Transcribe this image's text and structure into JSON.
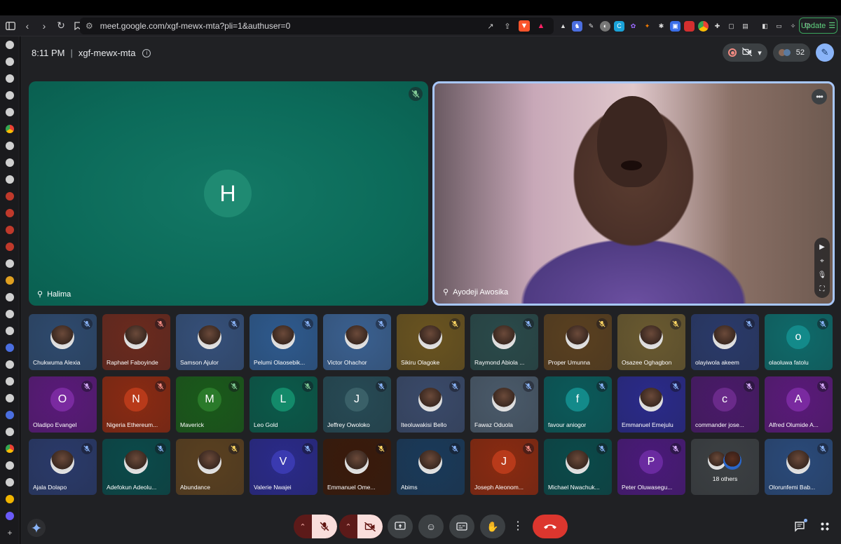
{
  "browser": {
    "url": "meet.google.com/xgf-mewx-mta?pli=1&authuser=0",
    "update_label": "Update"
  },
  "meeting": {
    "time": "8:11 PM",
    "code": "xgf-mewx-mta",
    "participant_count": "52"
  },
  "spotlight": [
    {
      "name": "Halima",
      "initial": "H"
    },
    {
      "name": "Ayodeji Awosika"
    }
  ],
  "participants": [
    {
      "name": "Chukwuma Alexia",
      "type": "photo",
      "bg": "#2e4a6e",
      "mic_color": "#8ab4f8"
    },
    {
      "name": "Raphael Faboyinde",
      "type": "photo",
      "bg": "#6b2a1e",
      "mic_color": "#f28b82"
    },
    {
      "name": "Samson Ajulor",
      "type": "photo",
      "bg": "#35507a",
      "mic_color": "#8ab4f8"
    },
    {
      "name": "Pelumi Olaosebik...",
      "type": "photo",
      "bg": "#2e5a8e",
      "mic_color": "#8ab4f8"
    },
    {
      "name": "Victor Ohachor",
      "type": "photo",
      "bg": "#3a6090",
      "mic_color": "#8ab4f8"
    },
    {
      "name": "Sikiru Olagoke",
      "type": "photo",
      "bg": "#6a5420",
      "mic_color": "#fdd663"
    },
    {
      "name": "Raymond Abiola ...",
      "type": "photo",
      "bg": "#2a4a4a",
      "mic_color": "#8ab4f8"
    },
    {
      "name": "Proper Umunna",
      "type": "photo",
      "bg": "#5a4020",
      "mic_color": "#fdd663"
    },
    {
      "name": "Osazee Oghagbon",
      "type": "photo",
      "bg": "#6a5a30",
      "mic_color": "#fdd663"
    },
    {
      "name": "olayiwola akeem",
      "type": "photo",
      "bg": "#2a3a6a",
      "mic_color": "#8ab4f8"
    },
    {
      "name": "olaoluwa fatolu",
      "type": "initial",
      "initial": "o",
      "bg": "#0e6a6a",
      "av": "#138a8a",
      "mic_color": "#8ab4f8"
    },
    {
      "name": "Oladipo Evangel",
      "type": "initial",
      "initial": "O",
      "bg": "#5a1a7a",
      "av": "#7a2aa0",
      "mic_color": "#d7aefb"
    },
    {
      "name": "Nigeria Ethereum...",
      "type": "initial",
      "initial": "N",
      "bg": "#8a2a12",
      "av": "#b83a1a",
      "mic_color": "#f28b82"
    },
    {
      "name": "Maverick",
      "type": "initial",
      "initial": "M",
      "bg": "#1a5a1a",
      "av": "#2a7a2a",
      "mic_color": "#81c995"
    },
    {
      "name": "Leo Gold",
      "type": "initial",
      "initial": "L",
      "bg": "#0a5a4a",
      "av": "#138a6a",
      "mic_color": "#81c995"
    },
    {
      "name": "Jeffrey Owoloko",
      "type": "initial",
      "initial": "J",
      "bg": "#264a55",
      "av": "#3a6068",
      "mic_color": "#8ab4f8"
    },
    {
      "name": "Iteoluwakisi Bello",
      "type": "photo",
      "bg": "#3a4a6a",
      "mic_color": "#8ab4f8"
    },
    {
      "name": "Fawaz Oduola",
      "type": "photo",
      "bg": "#4a5a6a",
      "mic_color": "#8ab4f8"
    },
    {
      "name": "favour aniogor",
      "type": "initial",
      "initial": "f",
      "bg": "#0a5a5a",
      "av": "#138a8a",
      "mic_color": "#8ab4f8"
    },
    {
      "name": "Emmanuel Emejulu",
      "type": "photo",
      "bg": "#2a2a8a",
      "mic_color": "#8ab4f8"
    },
    {
      "name": "commander jose...",
      "type": "initial",
      "initial": "c",
      "bg": "#4a1a6a",
      "av": "#6a2a8a",
      "mic_color": "#d7aefb"
    },
    {
      "name": "Alfred Olumide A...",
      "type": "initial",
      "initial": "A",
      "bg": "#5a1a7a",
      "av": "#7a2aa0",
      "mic_color": "#d7aefb"
    },
    {
      "name": "Ajala Dolapo",
      "type": "photo",
      "bg": "#2a3a6a",
      "mic_color": "#8ab4f8"
    },
    {
      "name": "Adefokun Adeolu...",
      "type": "photo",
      "bg": "#0a4a4a",
      "mic_color": "#8ab4f8"
    },
    {
      "name": "Abundance",
      "type": "photo",
      "bg": "#5a4020",
      "mic_color": "#fdd663"
    },
    {
      "name": "Valerie Nwajei",
      "type": "initial",
      "initial": "V",
      "bg": "#2a2a8a",
      "av": "#3a3ab0",
      "mic_color": "#8ab4f8"
    },
    {
      "name": "Emmanuel Ome...",
      "type": "photo",
      "bg": "#3a1a0a",
      "mic_color": "#fdd663"
    },
    {
      "name": "Abims",
      "type": "photo",
      "bg": "#1a3a5a",
      "mic_color": "#8ab4f8"
    },
    {
      "name": "Joseph Aleonom...",
      "type": "initial",
      "initial": "J",
      "bg": "#8a2a10",
      "av": "#b83a1a",
      "mic_color": "#f28b82"
    },
    {
      "name": "Michael Nwachuk...",
      "type": "photo",
      "bg": "#0a4a4a",
      "mic_color": "#8ab4f8"
    },
    {
      "name": "Peter Oluwasegu...",
      "type": "initial",
      "initial": "P",
      "bg": "#4a1a7a",
      "av": "#6a2aa0",
      "mic_color": "#d7aefb"
    },
    {
      "name": "18 others",
      "type": "others",
      "bg": "#3c4043",
      "mic_color": ""
    },
    {
      "name": "Olorunfemi Bab...",
      "type": "photo",
      "bg": "#2a4a7a",
      "mic_color": "#8ab4f8"
    }
  ],
  "icons": {
    "sidebar": "sidebar-toggle-icon",
    "back": "arrow-left-icon",
    "forward": "arrow-right-icon",
    "reload": "reload-icon",
    "bookmark": "bookmark-icon"
  },
  "colors": {
    "accent_blue": "#a8c7fa",
    "end_call": "#dc362e",
    "update_green": "#3ba55d"
  }
}
